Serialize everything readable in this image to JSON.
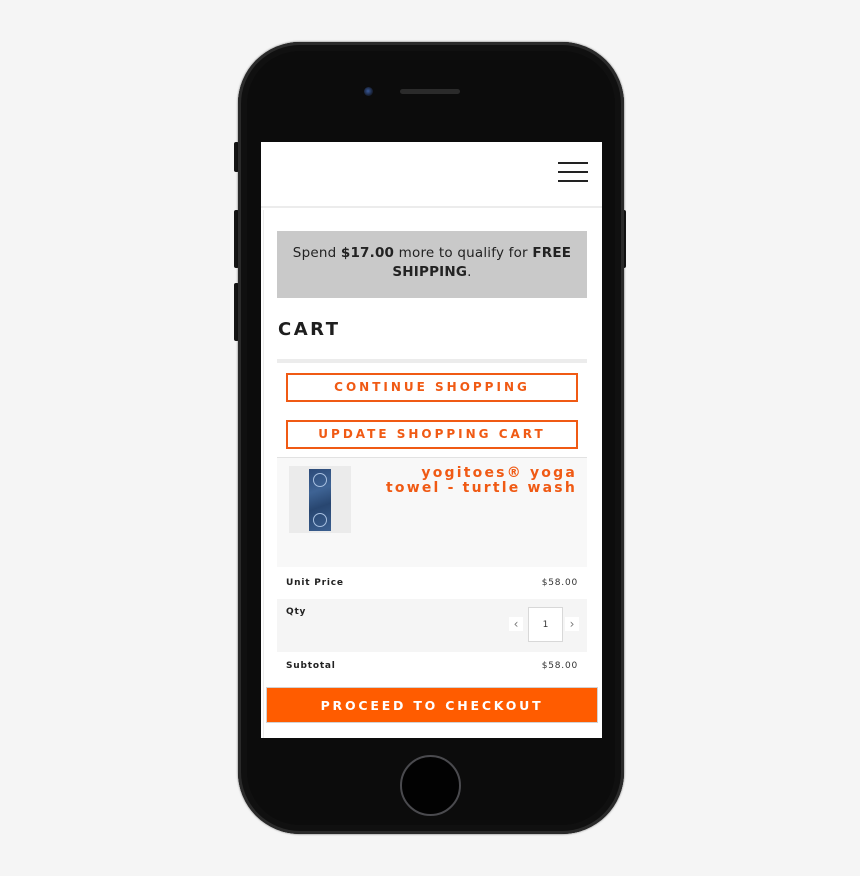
{
  "header": {
    "menu_icon": "hamburger-menu-icon"
  },
  "shipping_banner": {
    "prefix": "Spend ",
    "amount": "$17.00",
    "middle": " more to qualify for ",
    "highlight": "FREE SHIPPING",
    "suffix": "."
  },
  "cart": {
    "title": "CART",
    "continue_label": "CONTINUE SHOPPING",
    "update_label": "UPDATE SHOPPING CART",
    "items": [
      {
        "name": "yogitoes® yoga towel - turtle wash",
        "thumbnail": "yoga-towel-image",
        "unit_price_label": "Unit Price",
        "unit_price": "$58.00",
        "qty_label": "Qty",
        "qty": "1",
        "qty_decrement": "‹",
        "qty_increment": "›",
        "subtotal_label": "Subtotal",
        "subtotal": "$58.00"
      }
    ],
    "checkout_label": "PROCEED TO CHECKOUT"
  },
  "colors": {
    "accent": "#ff5c00",
    "accent_text": "#f05a14",
    "banner_bg": "#c9c9c9"
  }
}
